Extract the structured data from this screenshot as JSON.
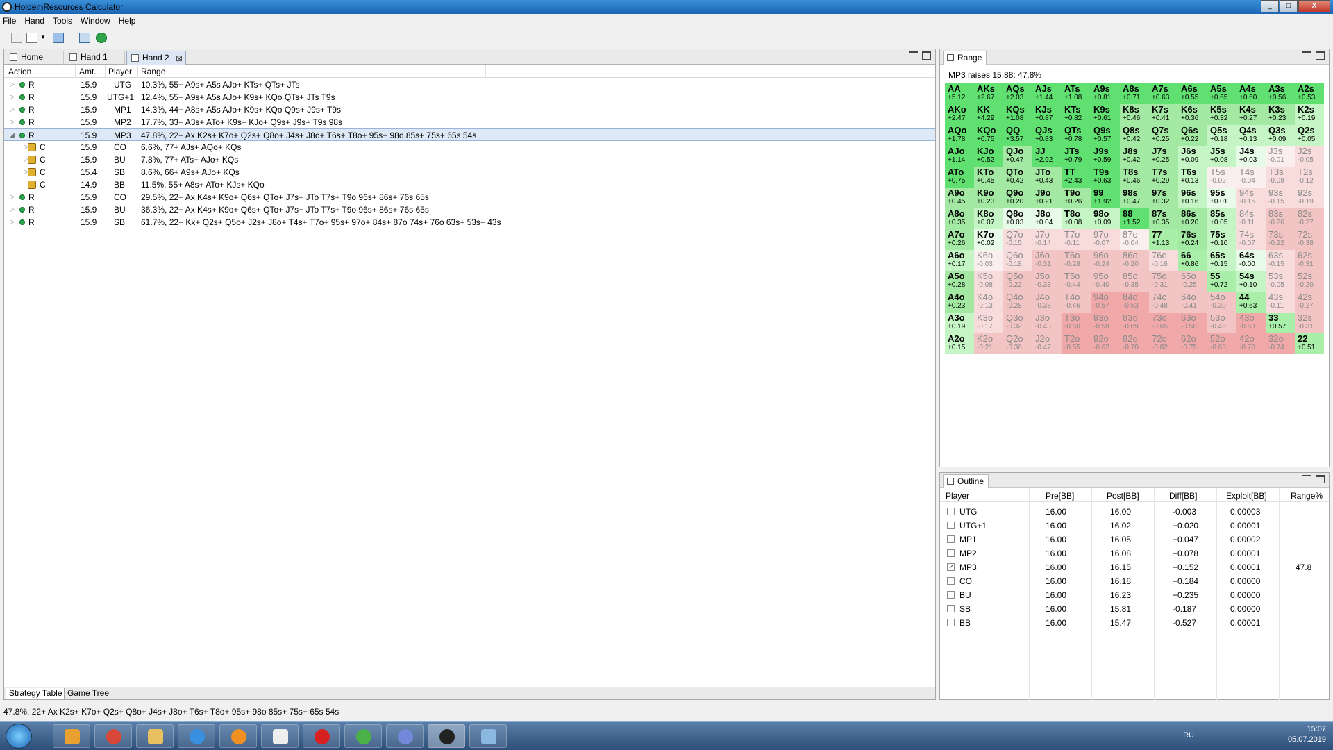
{
  "window": {
    "title": "HoldemResources Calculator",
    "min": "_",
    "max": "□",
    "close": "X"
  },
  "menu": [
    "File",
    "Hand",
    "Tools",
    "Window",
    "Help"
  ],
  "tabs": {
    "home": "Home",
    "hand1": "Hand 1",
    "hand2": "Hand 2",
    "close": "⊠"
  },
  "strategy": {
    "columns": {
      "action": "Action",
      "amt": "Amt.",
      "player": "Player",
      "range": "Range"
    },
    "rows": [
      {
        "level": 0,
        "tri": "▷",
        "icon": "dot",
        "action": "R",
        "amt": "15.9",
        "player": "UTG",
        "range": "10.3%, 55+ A9s+ A5s AJo+ KTs+ QTs+ JTs"
      },
      {
        "level": 0,
        "tri": "▷",
        "icon": "dot",
        "action": "R",
        "amt": "15.9",
        "player": "UTG+1",
        "range": "12.4%, 55+ A9s+ A5s AJo+ K9s+ KQo QTs+ JTs T9s"
      },
      {
        "level": 0,
        "tri": "▷",
        "icon": "dot",
        "action": "R",
        "amt": "15.9",
        "player": "MP1",
        "range": "14.3%, 44+ A8s+ A5s AJo+ K9s+ KQo Q9s+ J9s+ T9s"
      },
      {
        "level": 0,
        "tri": "▷",
        "icon": "dot",
        "action": "R",
        "amt": "15.9",
        "player": "MP2",
        "range": "17.7%, 33+ A3s+ ATo+ K9s+ KJo+ Q9s+ J9s+ T9s 98s"
      },
      {
        "level": 0,
        "tri": "◢",
        "icon": "dot",
        "action": "R",
        "amt": "15.9",
        "player": "MP3",
        "range": "47.8%, 22+ Ax K2s+ K7o+ Q2s+ Q8o+ J4s+ J8o+ T6s+ T8o+ 95s+ 98o 85s+ 75s+ 65s 54s",
        "selected": true
      },
      {
        "level": 1,
        "tri": "▷",
        "icon": "lock",
        "action": "C",
        "amt": "15.9",
        "player": "CO",
        "range": "6.6%, 77+ AJs+ AQo+ KQs"
      },
      {
        "level": 1,
        "tri": "▷",
        "icon": "lock",
        "action": "C",
        "amt": "15.9",
        "player": "BU",
        "range": "7.8%, 77+ ATs+ AJo+ KQs"
      },
      {
        "level": 1,
        "tri": "▷",
        "icon": "lock",
        "action": "C",
        "amt": "15.4",
        "player": "SB",
        "range": "8.6%, 66+ A9s+ AJo+ KQs"
      },
      {
        "level": 1,
        "tri": "",
        "icon": "lock",
        "action": "C",
        "amt": "14.9",
        "player": "BB",
        "range": "11.5%, 55+ A8s+ ATo+ KJs+ KQo"
      },
      {
        "level": 0,
        "tri": "▷",
        "icon": "dot",
        "action": "R",
        "amt": "15.9",
        "player": "CO",
        "range": "29.5%, 22+ Ax K4s+ K9o+ Q6s+ QTo+ J7s+ JTo T7s+ T9o 96s+ 86s+ 76s 65s"
      },
      {
        "level": 0,
        "tri": "▷",
        "icon": "dot",
        "action": "R",
        "amt": "15.9",
        "player": "BU",
        "range": "36.3%, 22+ Ax K4s+ K9o+ Q6s+ QTo+ J7s+ JTo T7s+ T9o 96s+ 86s+ 76s 65s"
      },
      {
        "level": 0,
        "tri": "▷",
        "icon": "dot",
        "action": "R",
        "amt": "15.9",
        "player": "SB",
        "range": "61.7%, 22+ Kx+ Q2s+ Q5o+ J2s+ J8o+ T4s+ T7o+ 95s+ 97o+ 84s+ 87o 74s+ 76o 63s+ 53s+ 43s"
      }
    ],
    "bottom_tabs": [
      "Strategy Table",
      "Game Tree"
    ]
  },
  "range": {
    "title": "Range",
    "header": "MP3 raises 15.88: 47.8%",
    "cells": [
      [
        [
          "AA",
          "+5.12"
        ],
        [
          "AKs",
          "+2.67"
        ],
        [
          "AQs",
          "+2.03"
        ],
        [
          "AJs",
          "+1.44"
        ],
        [
          "ATs",
          "+1.08"
        ],
        [
          "A9s",
          "+0.81"
        ],
        [
          "A8s",
          "+0.71"
        ],
        [
          "A7s",
          "+0.63"
        ],
        [
          "A6s",
          "+0.55"
        ],
        [
          "A5s",
          "+0.65"
        ],
        [
          "A4s",
          "+0.60"
        ],
        [
          "A3s",
          "+0.56"
        ],
        [
          "A2s",
          "+0.53"
        ]
      ],
      [
        [
          "AKo",
          "+2.47"
        ],
        [
          "KK",
          "+4.29"
        ],
        [
          "KQs",
          "+1.08"
        ],
        [
          "KJs",
          "+0.87"
        ],
        [
          "KTs",
          "+0.82"
        ],
        [
          "K9s",
          "+0.61"
        ],
        [
          "K8s",
          "+0.46"
        ],
        [
          "K7s",
          "+0.41"
        ],
        [
          "K6s",
          "+0.36"
        ],
        [
          "K5s",
          "+0.32"
        ],
        [
          "K4s",
          "+0.27"
        ],
        [
          "K3s",
          "+0.23"
        ],
        [
          "K2s",
          "+0.19"
        ]
      ],
      [
        [
          "AQo",
          "+1.78"
        ],
        [
          "KQo",
          "+0.75"
        ],
        [
          "QQ",
          "+3.57"
        ],
        [
          "QJs",
          "+0.83"
        ],
        [
          "QTs",
          "+0.78"
        ],
        [
          "Q9s",
          "+0.57"
        ],
        [
          "Q8s",
          "+0.42"
        ],
        [
          "Q7s",
          "+0.25"
        ],
        [
          "Q6s",
          "+0.22"
        ],
        [
          "Q5s",
          "+0.18"
        ],
        [
          "Q4s",
          "+0.13"
        ],
        [
          "Q3s",
          "+0.09"
        ],
        [
          "Q2s",
          "+0.05"
        ]
      ],
      [
        [
          "AJo",
          "+1.14"
        ],
        [
          "KJo",
          "+0.52"
        ],
        [
          "QJo",
          "+0.47"
        ],
        [
          "JJ",
          "+2.92"
        ],
        [
          "JTs",
          "+0.79"
        ],
        [
          "J9s",
          "+0.59"
        ],
        [
          "J8s",
          "+0.42"
        ],
        [
          "J7s",
          "+0.25"
        ],
        [
          "J6s",
          "+0.09"
        ],
        [
          "J5s",
          "+0.08"
        ],
        [
          "J4s",
          "+0.03"
        ],
        [
          "J3s",
          "-0.01"
        ],
        [
          "J2s",
          "-0.05"
        ]
      ],
      [
        [
          "ATo",
          "+0.75"
        ],
        [
          "KTo",
          "+0.45"
        ],
        [
          "QTo",
          "+0.42"
        ],
        [
          "JTo",
          "+0.43"
        ],
        [
          "TT",
          "+2.43"
        ],
        [
          "T9s",
          "+0.63"
        ],
        [
          "T8s",
          "+0.46"
        ],
        [
          "T7s",
          "+0.29"
        ],
        [
          "T6s",
          "+0.13"
        ],
        [
          "T5s",
          "-0.02"
        ],
        [
          "T4s",
          "-0.04"
        ],
        [
          "T3s",
          "-0.08"
        ],
        [
          "T2s",
          "-0.12"
        ]
      ],
      [
        [
          "A9o",
          "+0.45"
        ],
        [
          "K9o",
          "+0.23"
        ],
        [
          "Q9o",
          "+0.20"
        ],
        [
          "J9o",
          "+0.21"
        ],
        [
          "T9o",
          "+0.26"
        ],
        [
          "99",
          "+1.92"
        ],
        [
          "98s",
          "+0.47"
        ],
        [
          "97s",
          "+0.32"
        ],
        [
          "96s",
          "+0.16"
        ],
        [
          "95s",
          "+0.01"
        ],
        [
          "94s",
          "-0.15"
        ],
        [
          "93s",
          "-0.15"
        ],
        [
          "92s",
          "-0.19"
        ]
      ],
      [
        [
          "A8o",
          "+0.35"
        ],
        [
          "K8o",
          "+0.07"
        ],
        [
          "Q8o",
          "+0.03"
        ],
        [
          "J8o",
          "+0.04"
        ],
        [
          "T8o",
          "+0.08"
        ],
        [
          "98o",
          "+0.09"
        ],
        [
          "88",
          "+1.52"
        ],
        [
          "87s",
          "+0.35"
        ],
        [
          "86s",
          "+0.20"
        ],
        [
          "85s",
          "+0.05"
        ],
        [
          "84s",
          "-0.11"
        ],
        [
          "83s",
          "-0.26"
        ],
        [
          "82s",
          "-0.27"
        ]
      ],
      [
        [
          "A7o",
          "+0.26"
        ],
        [
          "K7o",
          "+0.02"
        ],
        [
          "Q7o",
          "-0.15"
        ],
        [
          "J7o",
          "-0.14"
        ],
        [
          "T7o",
          "-0.11"
        ],
        [
          "97o",
          "-0.07"
        ],
        [
          "87o",
          "-0.04"
        ],
        [
          "77",
          "+1.13"
        ],
        [
          "76s",
          "+0.24"
        ],
        [
          "75s",
          "+0.10"
        ],
        [
          "74s",
          "-0.07"
        ],
        [
          "73s",
          "-0.22"
        ],
        [
          "72s",
          "-0.38"
        ]
      ],
      [
        [
          "A6o",
          "+0.17"
        ],
        [
          "K6o",
          "-0.03"
        ],
        [
          "Q6o",
          "-0.18"
        ],
        [
          "J6o",
          "-0.31"
        ],
        [
          "T6o",
          "-0.28"
        ],
        [
          "96o",
          "-0.24"
        ],
        [
          "86o",
          "-0.20"
        ],
        [
          "76o",
          "-0.16"
        ],
        [
          "66",
          "+0.86"
        ],
        [
          "65s",
          "+0.15"
        ],
        [
          "64s",
          "-0.00"
        ],
        [
          "63s",
          "-0.15"
        ],
        [
          "62s",
          "-0.31"
        ]
      ],
      [
        [
          "A5o",
          "+0.28"
        ],
        [
          "K5o",
          "-0.08"
        ],
        [
          "Q5o",
          "-0.22"
        ],
        [
          "J5o",
          "-0.33"
        ],
        [
          "T5o",
          "-0.44"
        ],
        [
          "95o",
          "-0.40"
        ],
        [
          "85o",
          "-0.35"
        ],
        [
          "75o",
          "-0.31"
        ],
        [
          "65o",
          "-0.25"
        ],
        [
          "55",
          "+0.72"
        ],
        [
          "54s",
          "+0.10"
        ],
        [
          "53s",
          "-0.05"
        ],
        [
          "52s",
          "-0.20"
        ]
      ],
      [
        [
          "A4o",
          "+0.23"
        ],
        [
          "K4o",
          "-0.13"
        ],
        [
          "Q4o",
          "-0.28"
        ],
        [
          "J4o",
          "-0.38"
        ],
        [
          "T4o",
          "-0.46"
        ],
        [
          "94o",
          "-0.57"
        ],
        [
          "84o",
          "-0.53"
        ],
        [
          "74o",
          "-0.48"
        ],
        [
          "64o",
          "-0.41"
        ],
        [
          "54o",
          "-0.30"
        ],
        [
          "44",
          "+0.63"
        ],
        [
          "43s",
          "-0.11"
        ],
        [
          "42s",
          "-0.27"
        ]
      ],
      [
        [
          "A3o",
          "+0.19"
        ],
        [
          "K3o",
          "-0.17"
        ],
        [
          "Q3o",
          "-0.32"
        ],
        [
          "J3o",
          "-0.43"
        ],
        [
          "T3o",
          "-0.50"
        ],
        [
          "93o",
          "-0.58"
        ],
        [
          "83o",
          "-0.69"
        ],
        [
          "73o",
          "-0.65"
        ],
        [
          "63o",
          "-0.58"
        ],
        [
          "53o",
          "-0.46"
        ],
        [
          "43o",
          "-0.53"
        ],
        [
          "33",
          "+0.57"
        ],
        [
          "32s",
          "-0.31"
        ]
      ],
      [
        [
          "A2o",
          "+0.15"
        ],
        [
          "K2o",
          "-0.21"
        ],
        [
          "Q2o",
          "-0.36"
        ],
        [
          "J2o",
          "-0.47"
        ],
        [
          "T2o",
          "-0.55"
        ],
        [
          "92o",
          "-0.62"
        ],
        [
          "82o",
          "-0.70"
        ],
        [
          "72o",
          "-0.82"
        ],
        [
          "62o",
          "-0.75"
        ],
        [
          "52o",
          "-0.63"
        ],
        [
          "42o",
          "-0.70"
        ],
        [
          "32o",
          "-0.74"
        ],
        [
          "22",
          "+0.51"
        ]
      ]
    ]
  },
  "outline": {
    "title": "Outline",
    "columns": [
      "Player",
      "Pre[BB]",
      "Post[BB]",
      "Diff[BB]",
      "Exploit[BB]",
      "Range%"
    ],
    "rows": [
      {
        "player": "UTG",
        "pre": "16.00",
        "post": "16.00",
        "diff": "-0.003",
        "exploit": "0.00003",
        "range": "",
        "checked": false
      },
      {
        "player": "UTG+1",
        "pre": "16.00",
        "post": "16.02",
        "diff": "+0.020",
        "exploit": "0.00001",
        "range": "",
        "checked": false
      },
      {
        "player": "MP1",
        "pre": "16.00",
        "post": "16.05",
        "diff": "+0.047",
        "exploit": "0.00002",
        "range": "",
        "checked": false
      },
      {
        "player": "MP2",
        "pre": "16.00",
        "post": "16.08",
        "diff": "+0.078",
        "exploit": "0.00001",
        "range": "",
        "checked": false
      },
      {
        "player": "MP3",
        "pre": "16.00",
        "post": "16.15",
        "diff": "+0.152",
        "exploit": "0.00001",
        "range": "47.8",
        "checked": true
      },
      {
        "player": "CO",
        "pre": "16.00",
        "post": "16.18",
        "diff": "+0.184",
        "exploit": "0.00000",
        "range": "",
        "checked": false
      },
      {
        "player": "BU",
        "pre": "16.00",
        "post": "16.23",
        "diff": "+0.235",
        "exploit": "0.00000",
        "range": "",
        "checked": false
      },
      {
        "player": "SB",
        "pre": "16.00",
        "post": "15.81",
        "diff": "-0.187",
        "exploit": "0.00000",
        "range": "",
        "checked": false
      },
      {
        "player": "BB",
        "pre": "16.00",
        "post": "15.47",
        "diff": "-0.527",
        "exploit": "0.00001",
        "range": "",
        "checked": false
      }
    ]
  },
  "status": "47.8%, 22+ Ax K2s+ K7o+ Q2s+ Q8o+ J4s+ J8o+ T6s+ T8o+ 95s+ 98o 85s+ 75s+ 65s 54s",
  "taskbar": {
    "lang": "RU",
    "time": "15:07",
    "date": "05.07.2019"
  },
  "colors": {
    "green_strong": "#5fe070",
    "green_light": "#c5f5c5",
    "red_light": "#f8dcdc",
    "red_strong": "#f0a8a8",
    "accent": "#1c66b4"
  }
}
